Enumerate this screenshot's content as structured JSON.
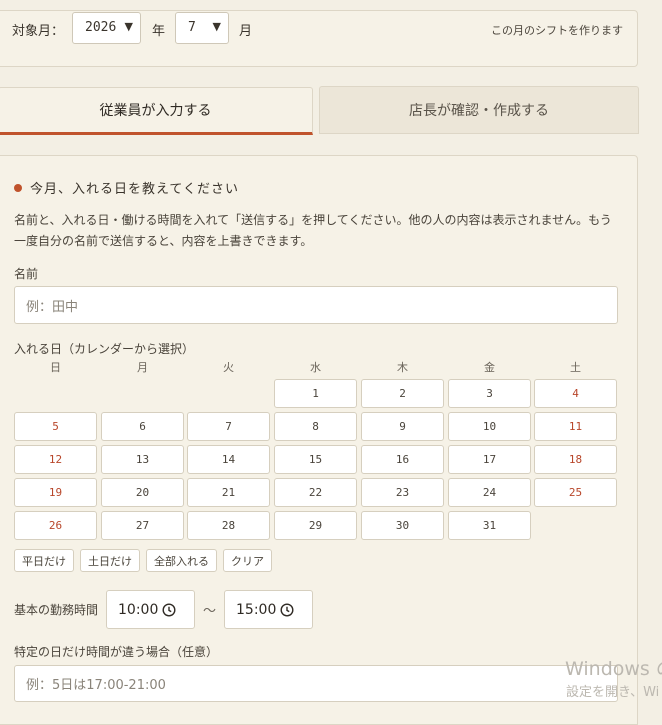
{
  "header": {
    "target_month_label": "対象月：",
    "year_value": "2026",
    "year_unit": "年",
    "month_value": "7",
    "month_unit": "月",
    "hint": "この月のシフトを作ります"
  },
  "tabs": [
    {
      "label": "従業員が入力する",
      "active": true
    },
    {
      "label": "店長が確認・作成する",
      "active": false
    }
  ],
  "form": {
    "section_title": "今月、入れる日を教えてください",
    "description": "名前と、入れる日・働ける時間を入れて「送信する」を押してください。他の人の内容は表示されません。もう一度自分の名前で送信すると、内容を上書きできます。",
    "name_label": "名前",
    "name_placeholder": "例：田中",
    "days_label": "入れる日（カレンダーから選択）",
    "weekdays": [
      "日",
      "月",
      "火",
      "水",
      "木",
      "金",
      "土"
    ],
    "calendar_days": [
      "1",
      "2",
      "3",
      "4",
      "5",
      "6",
      "7",
      "8",
      "9",
      "10",
      "11",
      "12",
      "13",
      "14",
      "15",
      "16",
      "17",
      "18",
      "19",
      "20",
      "21",
      "22",
      "23",
      "24",
      "25",
      "26",
      "27",
      "28",
      "29",
      "30",
      "31"
    ],
    "first_weekday_index": 3,
    "quick_buttons": [
      "平日だけ",
      "土日だけ",
      "全部入れる",
      "クリア"
    ],
    "work_time_label": "基本の勤務時間",
    "time_start": "10:00",
    "time_separator": "〜",
    "time_end": "15:00",
    "special_label": "特定の日だけ時間が違う場合（任意）",
    "special_placeholder": "例：5日は17:00-21:00"
  },
  "watermark": {
    "line1": "Windows の",
    "line2": "設定を開き、Wi"
  },
  "colors": {
    "accent": "#c0532c",
    "background": "#f3efe4",
    "card": "#f6f2e7"
  }
}
